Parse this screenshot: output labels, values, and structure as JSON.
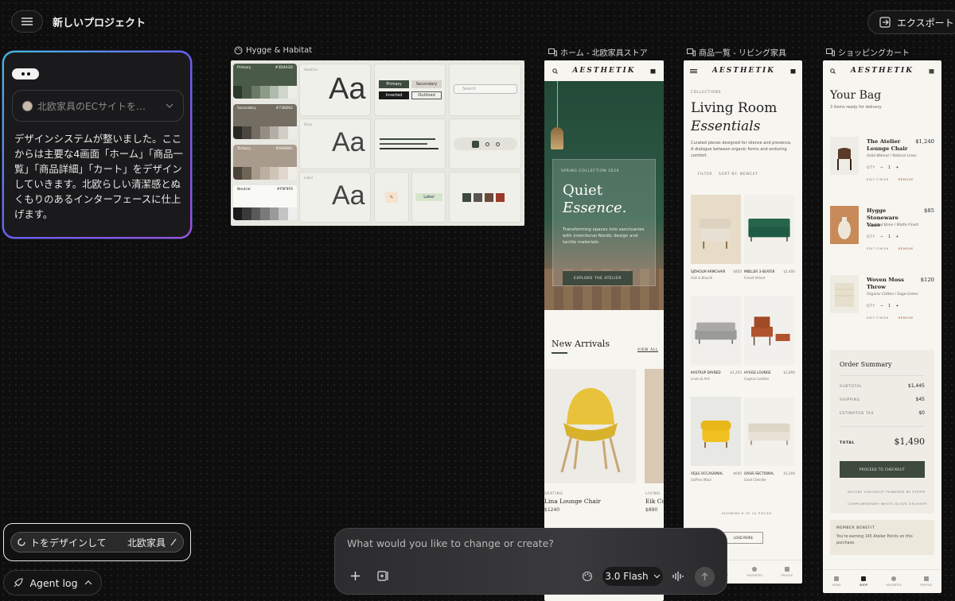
{
  "topbar": {
    "project_title": "新しいプロジェクト",
    "export_label": "エクスポート"
  },
  "chat": {
    "model_placeholder": "北欧家具のECサイトを…",
    "message": "デザインシステムが整いました。ここからは主要な4画面「ホーム」「商品一覧」「商品詳細」「カート」をデザインしていきます。北欧らしい清潔感とぬくもりのあるインターフェースに仕上げます。",
    "mini_prompt_left": "トをデザインして",
    "mini_prompt_right": "北欧家具",
    "agent_log_label": "Agent log"
  },
  "frames": {
    "design_system": {
      "label": "Hygge & Habitat",
      "swatches": [
        {
          "name": "Primary",
          "hex": "#3D4A3D",
          "color": "#4a5a48",
          "ramp": [
            "#2c3a2c",
            "#4a5a48",
            "#6a7a66",
            "#8c9a88",
            "#b0baac",
            "#d0d6cc",
            "#ecefe8"
          ]
        },
        {
          "name": "Secondary",
          "hex": "#736D62",
          "color": "#736d62",
          "ramp": [
            "#2a2824",
            "#4a4640",
            "#736d62",
            "#948e84",
            "#b4afa6",
            "#d2cec6",
            "#eeece8"
          ]
        },
        {
          "name": "Tertiary",
          "hex": "#A89B8C",
          "color": "#a89b8c",
          "ramp": [
            "#4a4238",
            "#6e6458",
            "#a89b8c",
            "#bcb0a2",
            "#cec4b8",
            "#e0d8ce",
            "#f2eee8"
          ]
        },
        {
          "name": "Neutral",
          "hex": "#F9F9F6",
          "color": "#f9f9f6",
          "ramp": [
            "#1a1a1a",
            "#3a3a3a",
            "#5a5a5a",
            "#7a7a7a",
            "#9a9a9a",
            "#c4c4c4",
            "#eeeeee"
          ]
        }
      ],
      "type_labels": [
        "Headline",
        "Body",
        "Label"
      ],
      "type_sample": "Aa",
      "buttons": {
        "primary": "Primary",
        "secondary": "Secondary",
        "inverted": "Inverted",
        "outlined": "Outlined"
      },
      "search_placeholder": "Search",
      "chip_label": "Label"
    },
    "home": {
      "label": "ホーム - 北欧家具ストア",
      "brand": "AESTHETIK",
      "hero_kicker": "SPRING COLLECTION 2024",
      "hero_title_1": "Quiet",
      "hero_title_2": "Essence.",
      "hero_body": "Transforming spaces into sanctuaries with intentional Nordic design and tactile materials.",
      "hero_cta": "EXPLORE THE ATELIER",
      "section_title": "New Arrivals",
      "view_all": "VIEW ALL",
      "products": [
        {
          "category": "SEATING",
          "name": "Lina Lounge Chair",
          "price": "$1240"
        },
        {
          "category": "LIVING",
          "name": "Eik Co",
          "price": "$890"
        }
      ]
    },
    "listing": {
      "label": "商品一覧 - リビング家具",
      "brand": "AESTHETIK",
      "kicker": "COLLECTIONS",
      "title_1": "Living Room",
      "title_2": "Essentials",
      "description": "Curated pieces designed for silence and presence. A dialogue between organic forms and enduring comfort.",
      "filter": "FILTER",
      "sort": "SORT BY: NEWEST",
      "products": [
        {
          "name": "SJÖHOLM ARMCHAIR",
          "price": "$850",
          "material": "Oak & Bouclé"
        },
        {
          "name": "MØLLER 3-SEATER",
          "price": "$2,400",
          "material": "Forest Velvet"
        },
        {
          "name": "KASTRUP DAYBED",
          "price": "$1,250",
          "material": "Linen & Ash"
        },
        {
          "name": "HYGGE LOUNGE",
          "price": "$1,890",
          "material": "Cognac Leather"
        },
        {
          "name": "VEJLE OCCASIONAL",
          "price": "$640",
          "material": "Saffron Wool"
        },
        {
          "name": "OASIS SECTIONAL",
          "price": "$3,200",
          "material": "Sand Chenille"
        }
      ],
      "pagination": "SHOWING 6 OF 24 PIECES",
      "load_more": "LOAD MORE",
      "nav": [
        "HOME",
        "SHOP",
        "FAVORITES",
        "PROFILE"
      ]
    },
    "cart": {
      "label": "ショッピングカート",
      "brand": "AESTHETIK",
      "title": "Your Bag",
      "subtitle": "3 items ready for delivery.",
      "items": [
        {
          "name": "The Atelier Lounge Chair",
          "price": "$1,240",
          "variant": "Solid Walnut / Natural Linen",
          "qty": "1"
        },
        {
          "name": "Hygge Stoneware Vase",
          "price": "$85",
          "variant": "Speckled Bone / Matte Finish",
          "qty": "1"
        },
        {
          "name": "Woven Moss Throw",
          "price": "$120",
          "variant": "Organic Cotton / Sage Green",
          "qty": "1"
        }
      ],
      "qty_label": "QTY",
      "edit": "EDIT FINISH",
      "remove": "REMOVE",
      "summary_title": "Order Summary",
      "subtotal_label": "SUBTOTAL",
      "subtotal": "$1,445",
      "shipping_label": "SHIPPING",
      "shipping": "$45",
      "tax_label": "ESTIMATED TAX",
      "tax": "$0",
      "total_label": "TOTAL",
      "total": "$1,490",
      "checkout": "PROCEED TO CHECKOUT",
      "secure": "SECURE CHECKOUT POWERED BY STRIPE",
      "delivery": "COMPLIMENTARY WHITE-GLOVE DELIVERY",
      "benefit_title": "MEMBER BENEFIT",
      "benefit_text": "You're earning 145 Atelier Points on this purchase.",
      "nav": [
        "HOME",
        "SHOP",
        "FAVORITES",
        "PROFILE"
      ]
    }
  },
  "composer": {
    "placeholder": "What would you like to change or create?",
    "model": "3.0 Flash"
  }
}
